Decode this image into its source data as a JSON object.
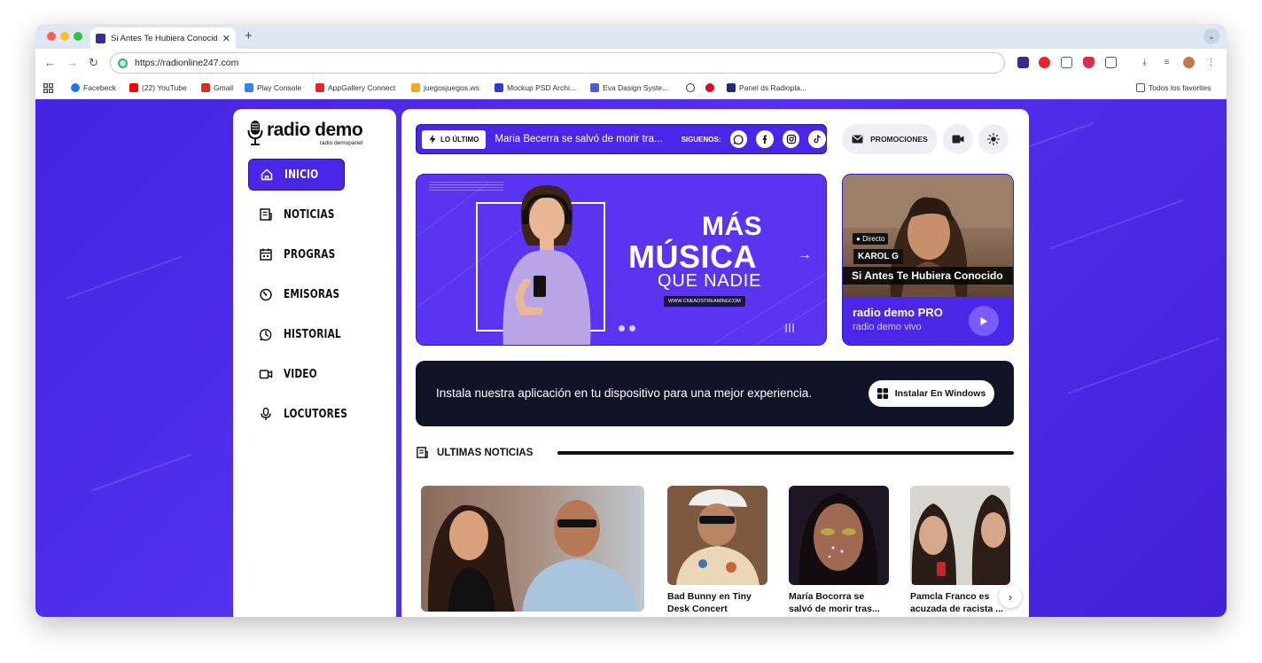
{
  "browser": {
    "tab_title": "Si Antes Te Hubiera Conocido",
    "url": "https://radionline247.com",
    "bookmarks": [
      {
        "label": "Facebeck",
        "color": "#1877f2"
      },
      {
        "label": "(22) YouTube",
        "color": "#ff0000"
      },
      {
        "label": "Gmail",
        "color": "#d93025"
      },
      {
        "label": "Play Console",
        "color": "#3b82f6"
      },
      {
        "label": "AppGallery Connect",
        "color": "#e0282e"
      },
      {
        "label": "juegosjuegos.ws",
        "color": "#f5a623"
      },
      {
        "label": "Mockup PSD Archi...",
        "color": "#2a3bd6"
      },
      {
        "label": "Eva Dasign Syste...",
        "color": "#4a5bd8"
      },
      {
        "label": "",
        "color": "#333333"
      },
      {
        "label": "",
        "color": "#e60023"
      },
      {
        "label": "Panel ds Radiopla...",
        "color": "#1c2c7a"
      }
    ],
    "bookmarks_folder": "Todos los favorites"
  },
  "sidebar": {
    "logo_title": "radio demo",
    "logo_sub": "radio demopanel",
    "items": [
      {
        "label": "INICIO",
        "icon": "home-icon",
        "active": true
      },
      {
        "label": "NOTICIAS",
        "icon": "news-icon",
        "active": false
      },
      {
        "label": "PROGRAS",
        "icon": "calendar-icon",
        "active": false
      },
      {
        "label": "EMISORAS",
        "icon": "radio-icon",
        "active": false
      },
      {
        "label": "HISTORIAL",
        "icon": "history-icon",
        "active": false
      },
      {
        "label": "VIDEO",
        "icon": "video-icon",
        "active": false
      },
      {
        "label": "LOCUTORES",
        "icon": "microphone-icon",
        "active": false
      }
    ]
  },
  "ticker": {
    "badge": "LO ÚLTIMO",
    "text": "Maria Becerra se salvó de morir tra...",
    "follow": "SIGUENOS:",
    "socials": [
      "whatsapp-icon",
      "facebook-icon",
      "instagram-icon",
      "tiktok-icon"
    ]
  },
  "header_buttons": {
    "promotions": "PROMOCIONES"
  },
  "banner": {
    "line1": "MÁS",
    "line2": "MÚSICA",
    "line3": "QUE NADIE",
    "url": "WWW.CNEAOSTREAMINGCOM"
  },
  "live": {
    "badge": "Directo",
    "artist": "KAROL G",
    "song": "Si Antes Te Hubiera Conocido",
    "station": "radio demo PRO",
    "station_sub": "radio demo vivo"
  },
  "install": {
    "text": "Instala nuestra aplicación en tu dispositivo para una mejor experiencia.",
    "button": "Instalar En Windows"
  },
  "news": {
    "heading": "ULTIMAS NOTICIAS",
    "items": [
      {
        "title": ""
      },
      {
        "title": "Bad Bunny en Tiny Desk Concert"
      },
      {
        "title": "María Bocorra se salvó de morir tras..."
      },
      {
        "title": "Pamcla Franco es acuzada de racista ..."
      }
    ]
  },
  "colors": {
    "accent": "#4a27e6",
    "dark": "#101426"
  }
}
